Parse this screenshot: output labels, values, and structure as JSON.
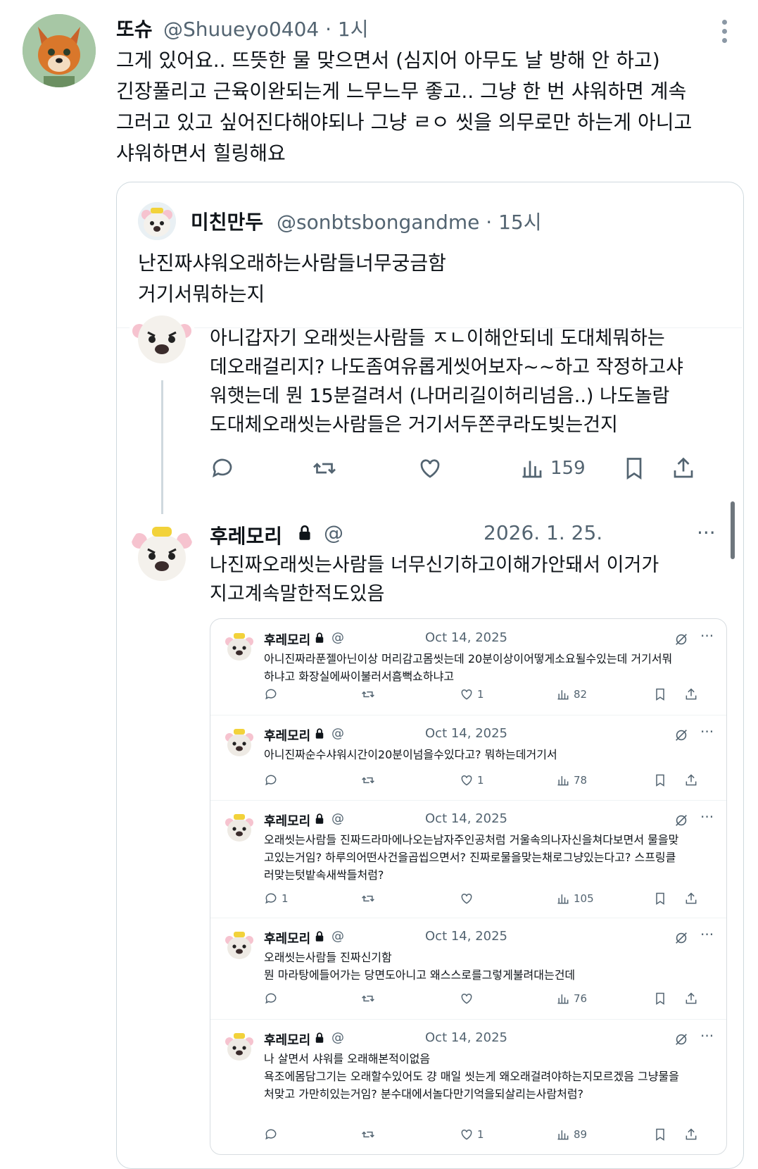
{
  "main": {
    "name": "또슈",
    "handle": "@Shuueyo0404 · 1시",
    "text": "그게 있어요.. 뜨뜻한 물 맞으면서 (심지어 아무도 날 방해 안 하고)\n긴장풀리고 근육이완되는게 느무느무 좋고.. 그냥 한 번 샤워하면 계속\n그러고 있고 싶어진다해야되나 그냥 ㄹㅇ 씻을 의무로만 하는게 아니고\n샤워하면서 힐링해요",
    "menu_icon": "more-vertical-icon"
  },
  "quote": {
    "name": "미친만두",
    "handle": "@sonbtsbongandme · 15시",
    "text": "난진짜샤워오래하는사람들너무궁금함\n거기서뭐하는지"
  },
  "thread": {
    "reply1": {
      "text": "아니갑자기 오래씻는사람들 ㅈㄴ이해안되네 도대체뭐하는\n데오래걸리지? 나도좀여유롭게씻어보자~~하고 작정하고샤\n워햇는데 뭔 15분걸려서 (나머리길이허리넘음..) 나도놀람\n도대체오래씻는사람들은 거기서두쫀쿠라도빚는건지",
      "views": "159"
    },
    "reply2": {
      "name": "후레모리",
      "at": "@",
      "date": "2026. 1. 25.",
      "more": "···",
      "text": "나진짜오래씻는사람들 너무신기하고이해가안돼서 이거가\n지고계속말한적도있음"
    }
  },
  "screenshot": {
    "tweets": [
      {
        "name": "후레모리",
        "at": "@",
        "date": "Oct 14, 2025",
        "text": "아니진짜라푼젤아닌이상 머리감고몸씻는데 20분이상이어떻게소요될수있는데 거기서뭐\n하냐고 화장실에싸이불러서흠뻑쇼하냐고",
        "replies": "",
        "likes": "1",
        "views": "82"
      },
      {
        "name": "후레모리",
        "at": "@",
        "date": "Oct 14, 2025",
        "text": "아니진짜순수샤워시간이20분이넘을수있다고? 뭐하는데거기서",
        "replies": "",
        "likes": "1",
        "views": "78"
      },
      {
        "name": "후레모리",
        "at": "@",
        "date": "Oct 14, 2025",
        "text": "오래씻는사람들 진짜드라마에나오는남자주인공처럼 거울속의나자신을쳐다보면서 물을맞\n고있는거임? 하루의어떤사건을곱씹으면서? 진짜로물을맞는채로그냥있는다고? 스프링클\n러맞는텃밭속새싹들처럼?",
        "replies": "1",
        "likes": "",
        "views": "105"
      },
      {
        "name": "후레모리",
        "at": "@",
        "date": "Oct 14, 2025",
        "text": "오래씻는사람들 진짜신기함\n뭔 마라탕에들어가는 당면도아니고 왜스스로를그렇게불려대는건데",
        "replies": "",
        "likes": "",
        "views": "76"
      },
      {
        "name": "후레모리",
        "at": "@",
        "date": "Oct 14, 2025",
        "text": "나 살면서 샤워를 오래해본적이없음\n욕조에몸담그기는 오래할수있어도 걍 매일 씻는게 왜오래걸려야하는지모르겠음 그냥물을\n처맞고 가만히있는거임? 분수대에서놀다만기억을되살리는사람처럼?",
        "replies": "",
        "likes": "1",
        "views": "89"
      }
    ]
  },
  "colors": {
    "text": "#0f1419",
    "secondary": "#536471",
    "border": "#cfd9de"
  }
}
